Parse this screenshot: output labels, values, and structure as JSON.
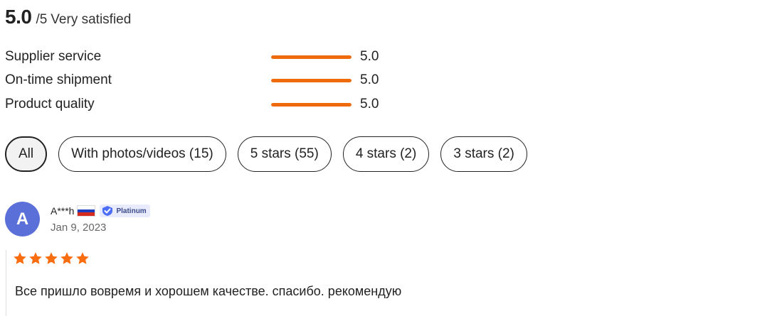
{
  "summary": {
    "score": "5.0",
    "out_of": "/5",
    "label": "Very satisfied"
  },
  "metrics": [
    {
      "label": "Supplier service",
      "value": "5.0",
      "fraction": 1.0
    },
    {
      "label": "On-time shipment",
      "value": "5.0",
      "fraction": 1.0
    },
    {
      "label": "Product quality",
      "value": "5.0",
      "fraction": 1.0
    }
  ],
  "filters": [
    {
      "label": "All",
      "active": true
    },
    {
      "label": "With photos/videos (15)",
      "active": false
    },
    {
      "label": "5 stars (55)",
      "active": false
    },
    {
      "label": "4 stars (2)",
      "active": false
    },
    {
      "label": "3 stars (2)",
      "active": false
    }
  ],
  "review": {
    "avatar_letter": "A",
    "avatar_color": "#5b6fd8",
    "user": "A***h",
    "country_flag_icon": "russia-flag-icon",
    "badge": "Platinum",
    "date": "Jan 9, 2023",
    "rating": 5,
    "text": "Все пришло вовремя и хорошем качестве. спасибо. рекомендую"
  },
  "colors": {
    "accent": "#ee6a0a",
    "star": "#f86d0f",
    "badge_bg": "#e7ebfb",
    "badge_icon": "#4c6ef5"
  }
}
